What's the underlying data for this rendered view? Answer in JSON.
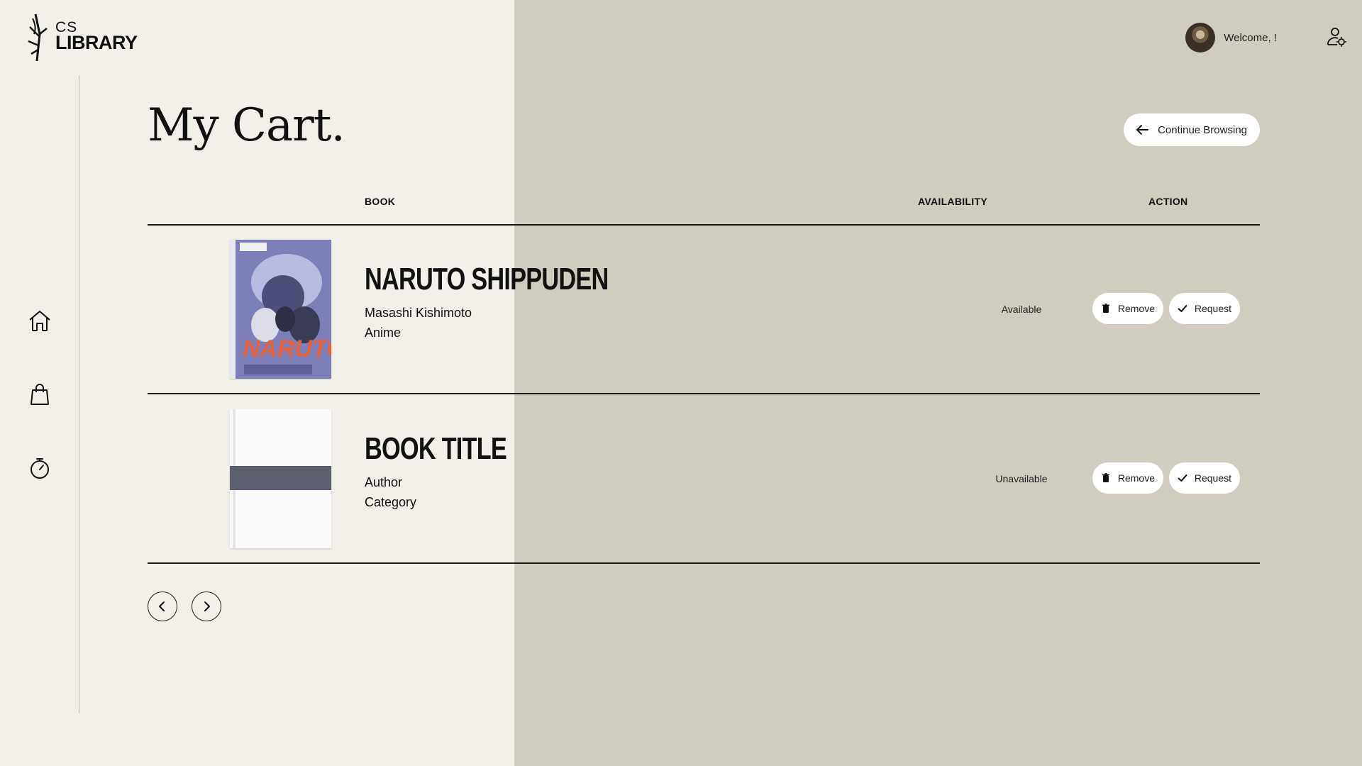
{
  "brand": {
    "line1": "CS",
    "line2": "LIBRARY"
  },
  "header": {
    "welcome": "Welcome, !"
  },
  "nav": [
    {
      "icon": "home-icon"
    },
    {
      "icon": "shopping-bag-icon"
    },
    {
      "icon": "stopwatch-icon"
    }
  ],
  "page": {
    "title": "My Cart.",
    "continue_label": "Continue Browsing"
  },
  "table": {
    "headers": {
      "book": "BOOK",
      "availability": "AVAILABILITY",
      "action": "ACTION"
    },
    "rows": [
      {
        "title": "NARUTO SHIPPUDEN",
        "author": "Masashi Kishimoto",
        "category": "Anime",
        "availability": "Available",
        "remove_label": "Remove",
        "request_label": "Request"
      },
      {
        "title": "BOOK TITLE",
        "author": "Author",
        "category": "Category",
        "availability": "Unavailable",
        "remove_label": "Remove",
        "request_label": "Request"
      }
    ]
  },
  "colors": {
    "left_panel": "#f3f0ea",
    "right_panel": "#d1ccc0",
    "button_bg": "#ffffff",
    "text": "#111111"
  }
}
